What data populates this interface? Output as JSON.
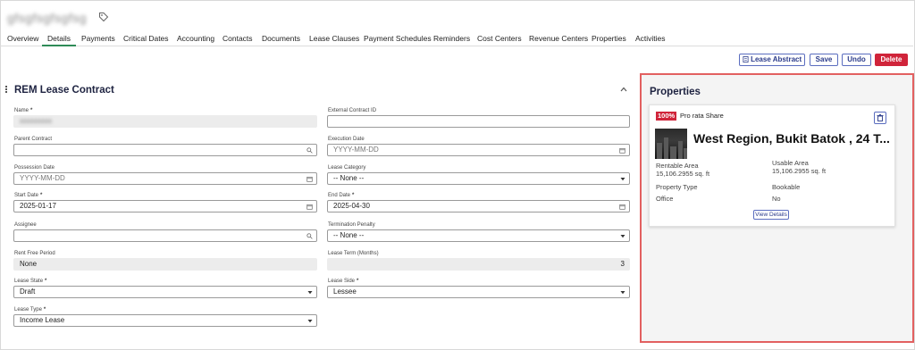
{
  "record": {
    "title": "gfsgfsgfsgfsg"
  },
  "tabs": [
    {
      "label": "Overview"
    },
    {
      "label": "Details"
    },
    {
      "label": "Payments"
    },
    {
      "label": "Critical Dates"
    },
    {
      "label": "Accounting"
    },
    {
      "label": "Contacts"
    },
    {
      "label": "Documents"
    },
    {
      "label": "Lease Clauses"
    },
    {
      "label": "Payment Schedules"
    },
    {
      "label": "Reminders"
    },
    {
      "label": "Cost Centers"
    },
    {
      "label": "Revenue Centers"
    },
    {
      "label": "Properties"
    },
    {
      "label": "Activities"
    }
  ],
  "active_tab": "Details",
  "toolbar": {
    "lease_abstract": "Lease Abstract",
    "save": "Save",
    "undo": "Undo",
    "delete": "Delete"
  },
  "section": {
    "title": "REM Lease Contract"
  },
  "form": {
    "name": {
      "label": "Name",
      "value": "xxxxxxxxx"
    },
    "external_contract_id": {
      "label": "External Contract ID",
      "value": ""
    },
    "parent_contract": {
      "label": "Parent Contract",
      "value": ""
    },
    "execution_date": {
      "label": "Execution Date",
      "placeholder": "YYYY-MM-DD"
    },
    "possession_date": {
      "label": "Possession Date",
      "placeholder": "YYYY-MM-DD"
    },
    "lease_category": {
      "label": "Lease Category",
      "value": "-- None --"
    },
    "start_date": {
      "label": "Start Date",
      "value": "2025-01-17"
    },
    "end_date": {
      "label": "End Date",
      "value": "2025-04-30"
    },
    "assignee": {
      "label": "Assignee",
      "value": ""
    },
    "termination_penalty": {
      "label": "Termination Penalty",
      "value": "-- None --"
    },
    "rent_free_period": {
      "label": "Rent Free Period",
      "value": "None"
    },
    "lease_term": {
      "label": "Lease Term (Months)",
      "value": "3"
    },
    "lease_state": {
      "label": "Lease State",
      "value": "Draft"
    },
    "lease_side": {
      "label": "Lease Side",
      "value": "Lessee"
    },
    "lease_type": {
      "label": "Lease Type",
      "value": "Income Lease"
    },
    "required_mark": "*"
  },
  "properties": {
    "title": "Properties",
    "card": {
      "pct": "100%",
      "pct_label": "Pro rata Share",
      "name": "West Region, Bukit Batok , 24 T...",
      "rentable_area_label": "Rentable Area",
      "rentable_area_value": "15,106.2955 sq. ft",
      "usable_area_label": "Usable Area",
      "usable_area_value": "15,106.2955 sq. ft",
      "property_type_label": "Property Type",
      "property_type_value": "Office",
      "bookable_label": "Bookable",
      "bookable_value": "No",
      "view_details": "View Details"
    }
  },
  "colors": {
    "accent": "#2e8b57",
    "danger": "#d0243a",
    "highlight_border": "#e26060",
    "link": "#5a6dbf"
  }
}
